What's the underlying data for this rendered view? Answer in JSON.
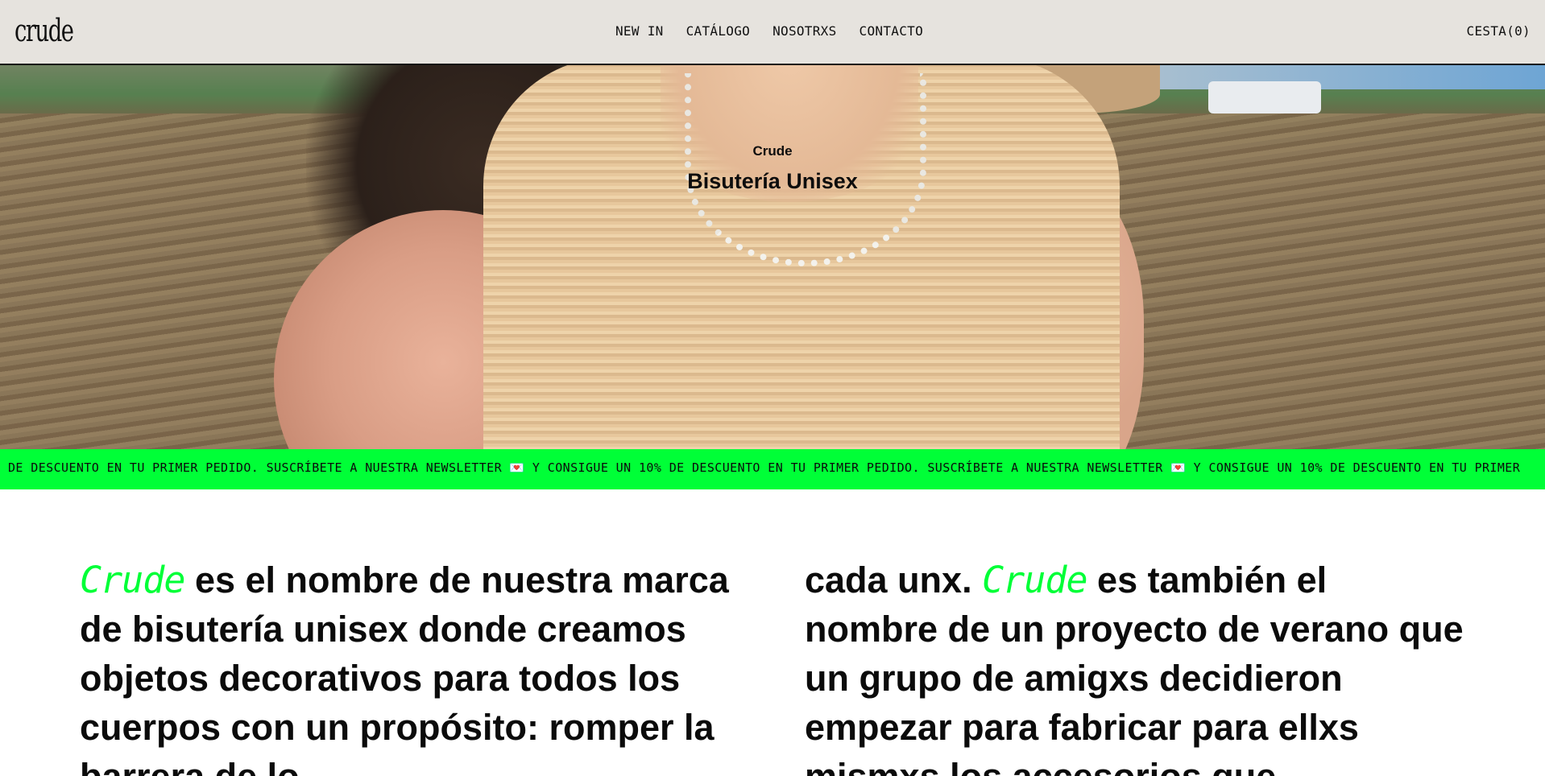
{
  "header": {
    "logo": "crude",
    "nav": [
      "NEW IN",
      "CATÁLOGO",
      "NOSOTRXS",
      "CONTACTO"
    ],
    "cart": "CESTA(0)"
  },
  "hero": {
    "brand": "Crude",
    "title": "Bisutería Unisex"
  },
  "marquee": {
    "text": "DE DESCUENTO EN TU PRIMER PEDIDO. SUSCRÍBETE A NUESTRA NEWSLETTER 💌 Y CONSIGUE UN 10% DE DESCUENTO EN TU PRIMER PEDIDO. SUSCRÍBETE A NUESTRA NEWSLETTER 💌 Y CONSIGUE UN 10% DE DESCUENTO EN TU PRIMER"
  },
  "intro": {
    "brand_word": "Crude",
    "left_text": " es el nombre de nuestra marca de bisutería unisex donde creamos objetos decorativos para todos los cuerpos con un propósito: romper la barrera de lo",
    "right_prefix": "cada unx. ",
    "right_text": " es también el nombre de un proyecto de verano que un grupo de amigxs decidieron empezar para fabricar para ellxs mismxs los accesorios que"
  },
  "colors": {
    "accent": "#00ff37",
    "header_bg": "#e6e3de",
    "text": "#0b0b0b"
  }
}
